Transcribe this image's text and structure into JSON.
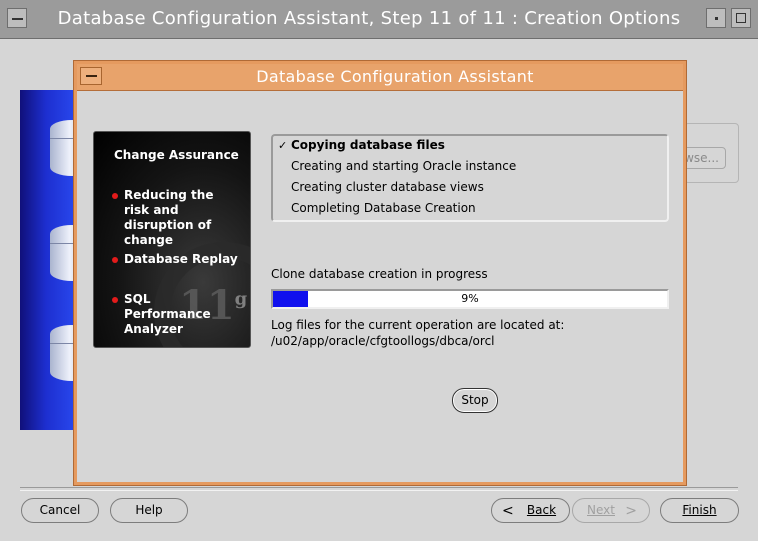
{
  "window": {
    "title": "Database Configuration Assistant, Step 11 of 11 : Creation Options",
    "browse_label": "owse..."
  },
  "dialog": {
    "title": "Database Configuration Assistant",
    "promo": {
      "heading": "Change Assurance",
      "items": [
        "Reducing the risk and disruption of change",
        "Database Replay",
        "SQL Performance Analyzer"
      ],
      "logo_text": "11",
      "logo_suffix": "g"
    },
    "steps": [
      {
        "label": "Copying database files",
        "current": true
      },
      {
        "label": "Creating and starting Oracle instance",
        "current": false
      },
      {
        "label": "Creating cluster database views",
        "current": false
      },
      {
        "label": "Completing Database Creation",
        "current": false
      }
    ],
    "status": "Clone database creation in progress",
    "progress": {
      "percent": 9,
      "label": "9%",
      "fill_color": "#1010ee"
    },
    "log_line1": "Log files for the current operation are located at:",
    "log_line2": "/u02/app/oracle/cfgtoollogs/dbca/orcl",
    "stop_label": "Stop"
  },
  "footer": {
    "cancel": "Cancel",
    "help": "Help",
    "back": "Back",
    "next": "Next",
    "finish": "Finish"
  },
  "colors": {
    "dialog_border": "#e59a5f",
    "outer_titlebar": "#9b9b9b",
    "promo_dot": "#e31b1b"
  }
}
